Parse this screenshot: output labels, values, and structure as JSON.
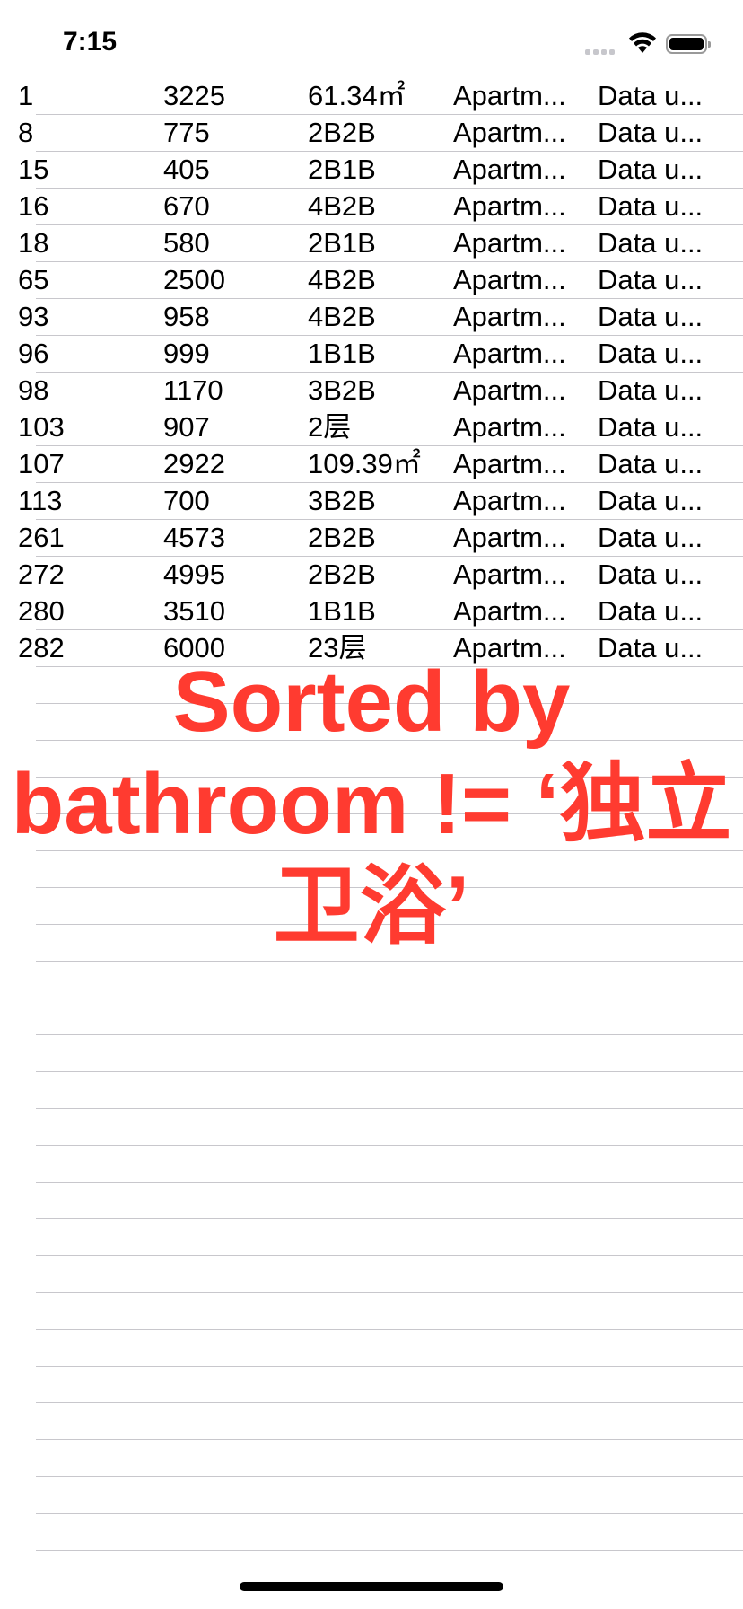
{
  "status_bar": {
    "time": "7:15"
  },
  "rows": [
    [
      "1",
      "3225",
      "61.34㎡",
      "Apartm...",
      "Data u..."
    ],
    [
      "8",
      "775",
      "2B2B",
      "Apartm...",
      "Data u..."
    ],
    [
      "15",
      "405",
      "2B1B",
      "Apartm...",
      "Data u..."
    ],
    [
      "16",
      "670",
      "4B2B",
      "Apartm...",
      "Data u..."
    ],
    [
      "18",
      "580",
      "2B1B",
      "Apartm...",
      "Data u..."
    ],
    [
      "65",
      "2500",
      "4B2B",
      "Apartm...",
      "Data u..."
    ],
    [
      "93",
      "958",
      "4B2B",
      "Apartm...",
      "Data u..."
    ],
    [
      "96",
      "999",
      "1B1B",
      "Apartm...",
      "Data u..."
    ],
    [
      "98",
      "1170",
      "3B2B",
      "Apartm...",
      "Data u..."
    ],
    [
      "103",
      "907",
      "2层",
      "Apartm...",
      "Data u..."
    ],
    [
      "107",
      "2922",
      "109.39㎡",
      "Apartm...",
      "Data u..."
    ],
    [
      "113",
      "700",
      "3B2B",
      "Apartm...",
      "Data u..."
    ],
    [
      "261",
      "4573",
      "2B2B",
      "Apartm...",
      "Data u..."
    ],
    [
      "272",
      "4995",
      "2B2B",
      "Apartm...",
      "Data u..."
    ],
    [
      "280",
      "3510",
      "1B1B",
      "Apartm...",
      "Data u..."
    ],
    [
      "282",
      "6000",
      "23层",
      "Apartm...",
      "Data u..."
    ]
  ],
  "overlay_text": "Sorted by bathroom != ‘独立卫浴’",
  "colors": {
    "annotation": "#ff3b30",
    "separator": "#c8c7cc"
  }
}
